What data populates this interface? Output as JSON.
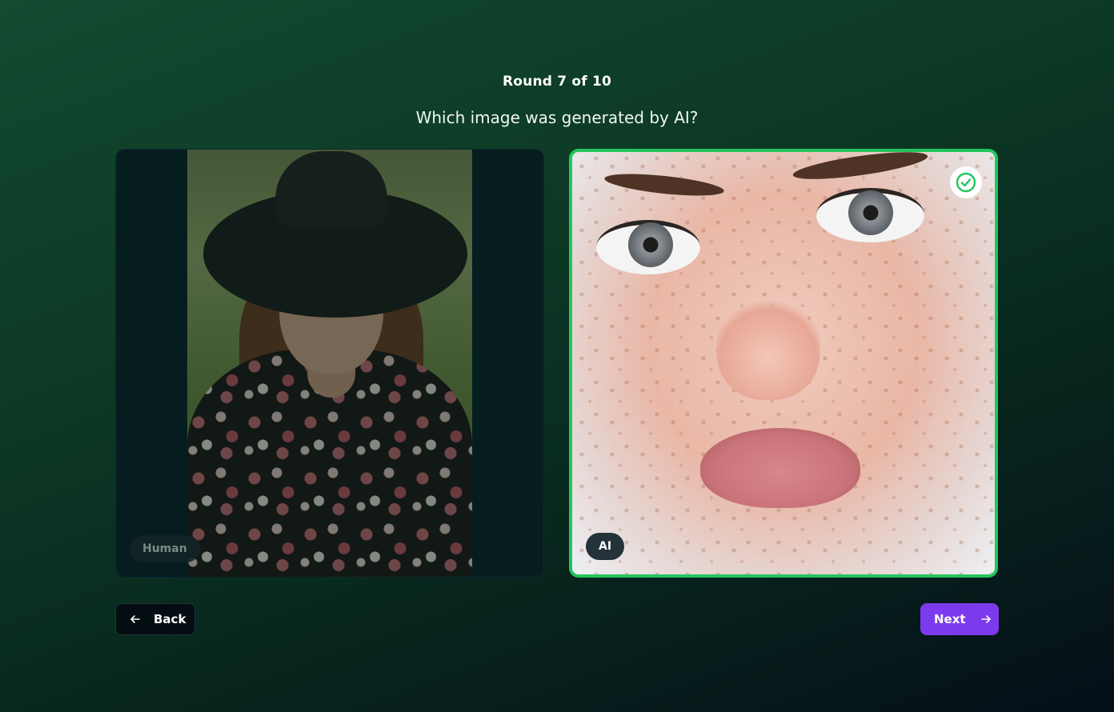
{
  "header": {
    "round_label": "Round 7 of 10",
    "question": "Which image was generated by AI?"
  },
  "cards": {
    "left": {
      "label": "Human",
      "image": "woman-in-hat-photo",
      "selected": false
    },
    "right": {
      "label": "AI",
      "image": "freckled-face-closeup",
      "selected": true,
      "icon": "check-circle-icon"
    }
  },
  "nav": {
    "back_label": "Back",
    "back_icon": "arrow-left-icon",
    "next_label": "Next",
    "next_icon": "arrow-right-icon"
  },
  "colors": {
    "selected_border": "#22c55e",
    "next_button": "#7c3aed",
    "back_button": "#040d12"
  }
}
